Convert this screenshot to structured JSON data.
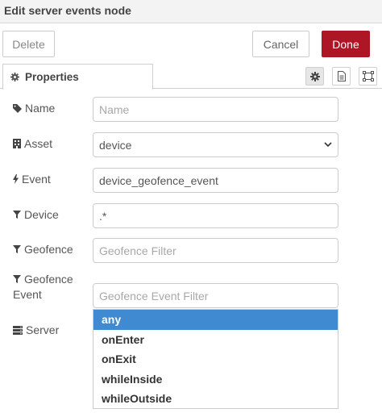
{
  "header": {
    "title": "Edit server events node"
  },
  "toolbar": {
    "delete_label": "Delete",
    "cancel_label": "Cancel",
    "done_label": "Done"
  },
  "tabs": {
    "properties_label": "Properties"
  },
  "form": {
    "name": {
      "label": "Name",
      "placeholder": "Name",
      "value": ""
    },
    "asset": {
      "label": "Asset",
      "value": "device"
    },
    "event": {
      "label": "Event",
      "value": "device_geofence_event"
    },
    "device": {
      "label": "Device",
      "value": ".*"
    },
    "geofence": {
      "label": "Geofence",
      "placeholder": "Geofence Filter",
      "value": ""
    },
    "geofence_event": {
      "label_line1": "Geofence",
      "label_line2": "Event",
      "placeholder": "Geofence Event Filter",
      "value": ""
    },
    "server": {
      "label": "Server"
    }
  },
  "dropdown": {
    "options": [
      "any",
      "onEnter",
      "onExit",
      "whileInside",
      "whileOutside"
    ],
    "highlighted": "any"
  },
  "colors": {
    "done": "#ad1625",
    "highlight": "#3f8ad1"
  },
  "icons": {
    "properties": "gear-icon",
    "description": "document-icon",
    "appearance": "frame-icon",
    "name": "tag-icon",
    "asset": "building-icon",
    "event": "bolt-icon",
    "device": "filter-icon",
    "geofence": "filter-icon",
    "geofence_event": "filter-icon",
    "server": "server-icon",
    "select": "chevron-down-icon"
  }
}
